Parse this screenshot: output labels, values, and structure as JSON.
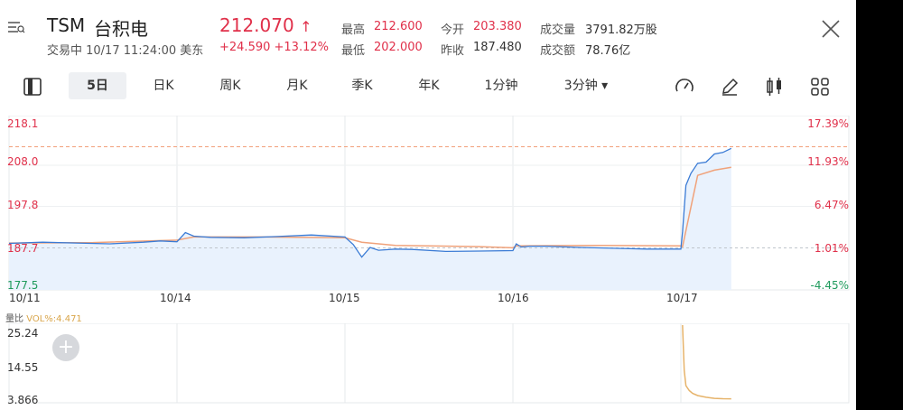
{
  "header": {
    "symbol": "TSM",
    "name": "台积电",
    "status": "交易中 10/17 11:24:00 美东",
    "price": "212.070",
    "change": "+24.590 +13.12%",
    "stats": [
      {
        "label": "最高",
        "value": "212.600",
        "tone": "red"
      },
      {
        "label": "今开",
        "value": "203.380",
        "tone": "red"
      },
      {
        "label": "成交量",
        "value": "3791.82万股",
        "tone": "dark"
      },
      {
        "label": "最低",
        "value": "202.000",
        "tone": "red"
      },
      {
        "label": "昨收",
        "value": "187.480",
        "tone": "dark"
      },
      {
        "label": "成交额",
        "value": "78.76亿",
        "tone": "dark"
      }
    ]
  },
  "toolbar": {
    "tabs": [
      "5日",
      "日K",
      "周K",
      "月K",
      "季K",
      "年K",
      "1分钟",
      "3分钟 ▾"
    ],
    "active": "5日"
  },
  "icons": [
    "menu-icon",
    "close-icon",
    "panel-icon",
    "speedometer-icon",
    "pencil-icon",
    "candlestick-icon",
    "grid-icon",
    "plus-icon"
  ],
  "colors": {
    "up": "#e0304a",
    "down": "#1e9a5c",
    "price_line": "#3a7bd5",
    "avg_line": "#f0a27a",
    "area": "#e9f2fd",
    "volume_line": "#e6b36a",
    "ref_line": "#f2a07b"
  },
  "chart_data": [
    {
      "type": "line",
      "title": "",
      "x_labels": [
        "10/11",
        "10/14",
        "10/15",
        "10/16",
        "10/17"
      ],
      "y_labels": [
        "218.1",
        "208.0",
        "197.8",
        "187.7",
        "177.5"
      ],
      "y_right_labels": [
        "17.39%",
        "11.93%",
        "6.47%",
        "1.01%",
        "-4.45%"
      ],
      "ylim": [
        177.5,
        218.1
      ],
      "series": [
        {
          "role": "price",
          "x": [
            0,
            0.2,
            0.4,
            0.6,
            0.8,
            0.9,
            1.0,
            1.05,
            1.1,
            1.2,
            1.4,
            1.6,
            1.8,
            2.0,
            2.05,
            2.1,
            2.15,
            2.2,
            2.3,
            2.4,
            2.6,
            2.8,
            3.0,
            3.02,
            3.05,
            3.1,
            3.2,
            3.4,
            3.6,
            3.8,
            4.0,
            4.01,
            4.03,
            4.06,
            4.1,
            4.15,
            4.2,
            4.25,
            4.3
          ],
          "values": [
            188.6,
            188.9,
            188.7,
            188.5,
            188.9,
            189.2,
            189.0,
            191.3,
            190.4,
            190.1,
            190.0,
            190.3,
            190.7,
            190.2,
            188.3,
            185.2,
            187.6,
            186.9,
            187.2,
            187.1,
            186.6,
            186.7,
            186.8,
            188.5,
            187.7,
            187.9,
            187.9,
            187.6,
            187.4,
            187.2,
            187.2,
            191.5,
            203.0,
            206.0,
            208.5,
            208.8,
            210.8,
            211.2,
            212.2
          ]
        },
        {
          "role": "average",
          "x": [
            0,
            0.5,
            1.0,
            1.1,
            1.5,
            2.0,
            2.1,
            2.3,
            2.8,
            3.0,
            3.02,
            3.5,
            4.0,
            4.01,
            4.1,
            4.2,
            4.3
          ],
          "values": [
            188.7,
            188.8,
            189.4,
            190.2,
            190.2,
            190.0,
            188.9,
            188.1,
            187.8,
            187.5,
            188.0,
            188.1,
            188.0,
            187.8,
            205.5,
            206.8,
            207.5
          ]
        },
        {
          "role": "previous_close",
          "x": [
            0,
            4.3
          ],
          "values": [
            187.48,
            187.48
          ]
        },
        {
          "role": "high",
          "x": [
            0,
            4.3
          ],
          "values": [
            212.6,
            212.6
          ]
        }
      ]
    },
    {
      "type": "line",
      "title": "",
      "label_prefix": "量比",
      "label": "VOL%:4.471",
      "y_labels": [
        "25.24",
        "14.55",
        "3.866"
      ],
      "ylim": [
        3.866,
        25.24
      ],
      "series": [
        {
          "role": "volume_ratio",
          "x": [
            4.01,
            4.02,
            4.03,
            4.05,
            4.07,
            4.1,
            4.15,
            4.2,
            4.25,
            4.3
          ],
          "values": [
            25.24,
            12.5,
            8.2,
            6.8,
            6.0,
            5.4,
            4.9,
            4.6,
            4.5,
            4.47
          ]
        }
      ]
    }
  ]
}
